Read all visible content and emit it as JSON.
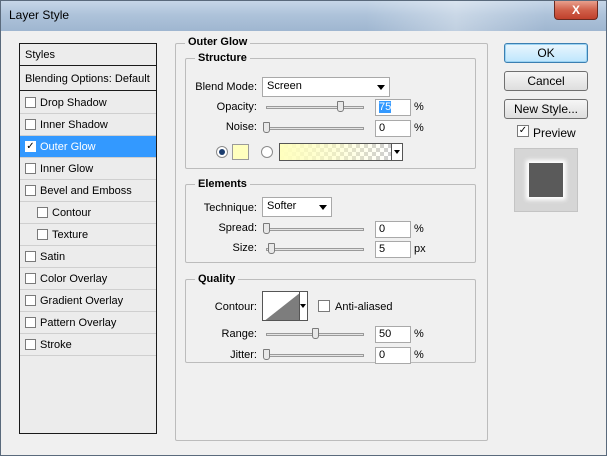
{
  "window": {
    "title": "Layer Style",
    "close_glyph": "X"
  },
  "styles_list": {
    "header": "Styles",
    "blending": "Blending Options: Default",
    "items": [
      {
        "label": "Drop Shadow",
        "checked": false,
        "indent": false
      },
      {
        "label": "Inner Shadow",
        "checked": false,
        "indent": false
      },
      {
        "label": "Outer Glow",
        "checked": true,
        "indent": false,
        "selected": true
      },
      {
        "label": "Inner Glow",
        "checked": false,
        "indent": false
      },
      {
        "label": "Bevel and Emboss",
        "checked": false,
        "indent": false
      },
      {
        "label": "Contour",
        "checked": false,
        "indent": true
      },
      {
        "label": "Texture",
        "checked": false,
        "indent": true
      },
      {
        "label": "Satin",
        "checked": false,
        "indent": false
      },
      {
        "label": "Color Overlay",
        "checked": false,
        "indent": false
      },
      {
        "label": "Gradient Overlay",
        "checked": false,
        "indent": false
      },
      {
        "label": "Pattern Overlay",
        "checked": false,
        "indent": false
      },
      {
        "label": "Stroke",
        "checked": false,
        "indent": false
      }
    ],
    "check_glyph": "✓"
  },
  "outer_glow": {
    "title": "Outer Glow",
    "structure": {
      "title": "Structure",
      "blend_mode_label": "Blend Mode:",
      "blend_mode_value": "Screen",
      "opacity_label": "Opacity:",
      "opacity_value": "75",
      "opacity_unit": "%",
      "opacity_level": 0.75,
      "noise_label": "Noise:",
      "noise_value": "0",
      "noise_unit": "%",
      "noise_level": 0,
      "glow_color": "#ffffbe"
    },
    "elements": {
      "title": "Elements",
      "technique_label": "Technique:",
      "technique_value": "Softer",
      "spread_label": "Spread:",
      "spread_value": "0",
      "spread_unit": "%",
      "size_label": "Size:",
      "size_value": "5",
      "size_unit": "px"
    },
    "quality": {
      "title": "Quality",
      "contour_label": "Contour:",
      "anti_aliased_label": "Anti-aliased",
      "anti_aliased": false,
      "range_label": "Range:",
      "range_value": "50",
      "range_unit": "%",
      "range_level": 0.5,
      "jitter_label": "Jitter:",
      "jitter_value": "0",
      "jitter_unit": "%"
    }
  },
  "buttons": {
    "ok": "OK",
    "cancel": "Cancel",
    "new_style": "New Style...",
    "preview_label": "Preview",
    "preview_checked": true
  },
  "colors": {
    "selection": "#3399ff",
    "preview_layer": "#5a5a5a"
  }
}
